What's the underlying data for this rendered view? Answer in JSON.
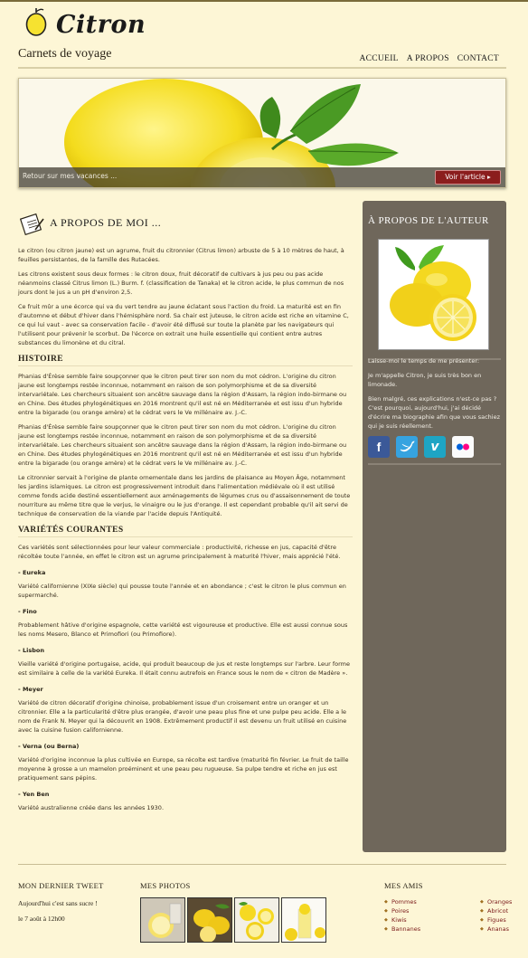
{
  "header": {
    "logo_text": "Citron",
    "tagline": "Carnets de voyage",
    "nav": [
      "ACCUEIL",
      "A PROPOS",
      "CONTACT"
    ]
  },
  "hero": {
    "caption": "Retour sur mes vacances ...",
    "button": "Voir l'article"
  },
  "main": {
    "title": "A PROPOS DE MOI ...",
    "intro": [
      "Le citron (ou citron jaune) est un agrume, fruit du citronnier (Citrus limon) arbuste de 5 à 10 mètres de haut, à feuilles persistantes, de la famille des Rutacées.",
      "Les citrons existent sous deux formes : le citron doux, fruit décoratif de cultivars à jus peu ou pas acide néanmoins classé Citrus limon (L.) Burm. f. (classification de Tanaka) et le citron acide, le plus commun de nos jours dont le jus a un pH d'environ 2,5.",
      "Ce fruit mûr a une écorce qui va du vert tendre au jaune éclatant sous l'action du froid. La maturité est en fin d'automne et début d'hiver dans l'hémisphère nord. Sa chair est juteuse, le citron acide est riche en vitamine C, ce qui lui vaut - avec sa conservation facile - d'avoir été diffusé sur toute la planète par les navigateurs qui l'utilisent pour prévenir le scorbut. De l'écorce on extrait une huile essentielle qui contient entre autres substances du limonène et du citral."
    ],
    "history_title": "HISTOIRE",
    "history": [
      "Phanias d'Érèse semble faire soupçonner que le citron peut tirer son nom du mot cédron. L'origine du citron jaune est longtemps restée inconnue, notamment en raison de son polymorphisme et de sa diversité intervariétale. Les chercheurs situaient son ancêtre sauvage dans la région d'Assam, la région indo-birmane ou en Chine. Des études phylogénétiques en 2016 montrent qu'il est né en Méditerranée et est issu d'un hybride entre la bigarade (ou orange amère) et le cédrat vers le Ve millénaire av. J.-C.",
      "Phanias d'Érèse semble faire soupçonner que le citron peut tirer son nom du mot cédron. L'origine du citron jaune est longtemps restée inconnue, notamment en raison de son polymorphisme et de sa diversité intervariétale. Les chercheurs situaient son ancêtre sauvage dans la région d'Assam, la région indo-birmane ou en Chine. Des études phylogénétiques en 2016 montrent qu'il est né en Méditerranée et est issu d'un hybride entre la bigarade (ou orange amère) et le cédrat vers le Ve millénaire av. J.-C.",
      "Le citronnier servait à l'origine de plante ornementale dans les jardins de plaisance au Moyen Âge, notamment les jardins islamiques. Le citron est progressivement introduit dans l'alimentation médiévale où il est utilisé comme fonds acide destiné essentiellement aux aménagements de légumes crus ou d'assaisonnement de toute nourriture au même titre que le verjus, le vinaigre ou le jus d'orange. Il est cependant probable qu'il ait servi de technique de conservation de la viande par l'acide depuis l'Antiquité."
    ],
    "varieties_title": "VARIÉTÉS COURANTES",
    "varieties_intro": "Ces variétés sont sélectionnées pour leur valeur commerciale : productivité, richesse en jus, capacité d'être récoltée toute l'année, en effet le citron est un agrume principalement à maturité l'hiver, mais apprécié l'été.",
    "varieties": [
      {
        "name": "- Eureka",
        "desc": "Variété californienne (XIXe siècle) qui pousse toute l'année et en abondance ; c'est le citron le plus commun en supermarché."
      },
      {
        "name": "- Fino",
        "desc": "Probablement hâtive d'origine espagnole, cette variété est vigoureuse et productive. Elle est aussi connue sous les noms Mesero, Blanco et Primofiori (ou Primofiore)."
      },
      {
        "name": "- Lisbon",
        "desc": "Vieille variété d'origine portugaise, acide, qui produit beaucoup de jus et reste longtemps sur l'arbre. Leur forme est similaire à celle de la variété Eureka. Il était connu autrefois en France sous le nom de « citron de Madère »."
      },
      {
        "name": "- Meyer",
        "desc": "Variété de citron décoratif d'origine chinoise, probablement issue d'un croisement entre un oranger et un citronnier. Elle a la particularité d'être plus orangée, d'avoir une peau plus fine et une pulpe peu acide. Elle a le nom de Frank N. Meyer qui la découvrit en 1908. Extrêmement productif il est devenu un fruit utilisé en cuisine avec la cuisine fusion californienne."
      },
      {
        "name": "- Verna (ou Berna)",
        "desc": "Variété d'origine inconnue la plus cultivée en Europe, sa récolte est tardive (maturité fin février. Le fruit de taille moyenne à grosse a un mamelon proéminent et une peau peu rugueuse. Sa pulpe tendre et riche en jus est pratiquement sans pépins."
      },
      {
        "name": "- Yen Ben",
        "desc": "Variété australienne créée dans les années 1930."
      }
    ]
  },
  "sidebar": {
    "title": "À PROPOS DE L'AUTEUR",
    "text1": "Laisse-moi le temps de me présenter:",
    "text2": "Je m'appelle Citron, je suis très bon en limonade.",
    "text3": "Bien malgré, ces explications n'est-ce pas ? C'est pourquoi, aujourd'hui, j'ai décidé d'écrire ma biographie afin que vous sachiez qui je suis réellement.",
    "social": [
      "facebook-icon",
      "twitter-icon",
      "vimeo-icon",
      "flickr-icon"
    ]
  },
  "footer": {
    "tweet_title": "MON DERNIER TWEET",
    "tweet_text": "Aujourd'hui c'est sans sucre !",
    "tweet_date": "le 7 août à 12h00",
    "photos_title": "MES PHOTOS",
    "friends_title": "MES AMIS",
    "friends_col1": [
      "Pommes",
      "Poires",
      "Kiwis",
      "Bannanes"
    ],
    "friends_col2": [
      "Oranges",
      "Abricot",
      "Figues",
      "Ananas"
    ]
  },
  "colors": {
    "background": "#fdf6d6",
    "sidebar": "#6f675b",
    "button": "#8b1d1d",
    "link": "#7a1a1a"
  }
}
